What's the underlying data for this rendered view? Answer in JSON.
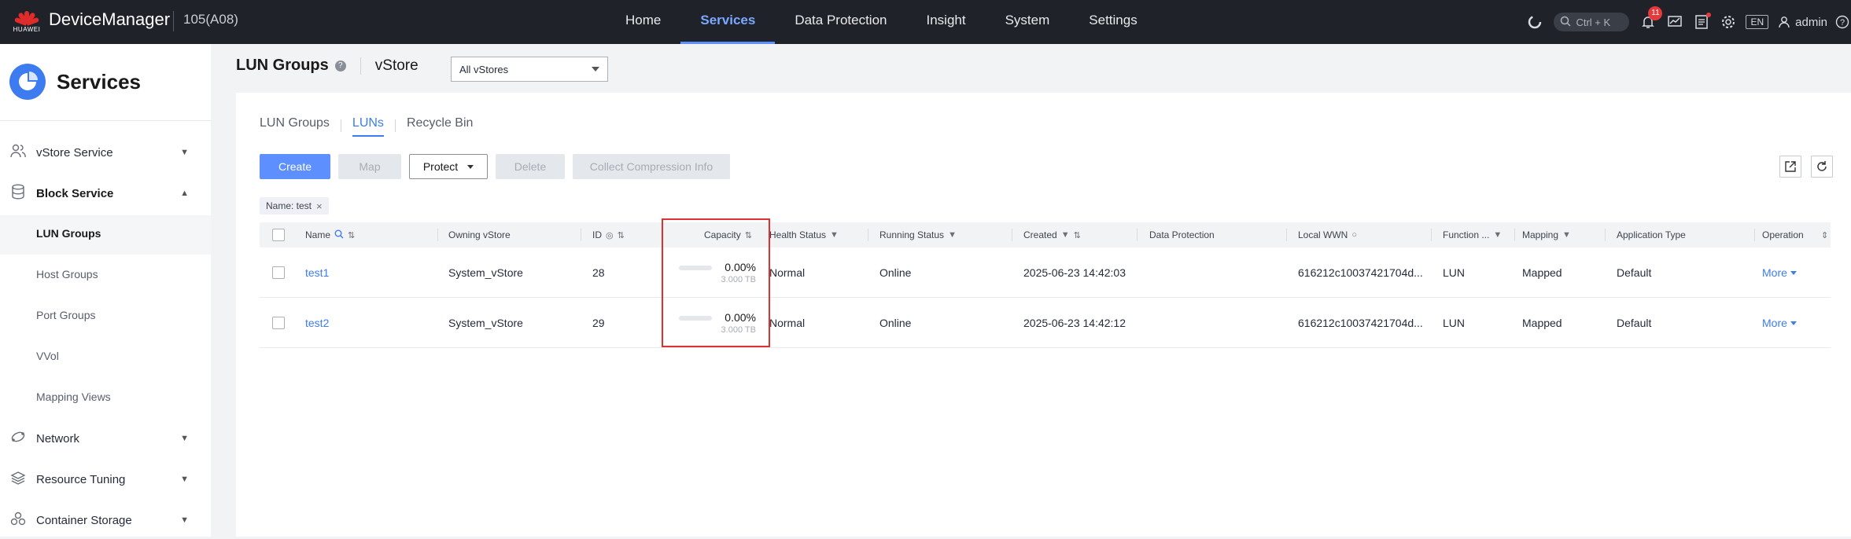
{
  "topbar": {
    "brand": "HUAWEI",
    "app_title": "DeviceManager",
    "device": "105(A08)",
    "nav": [
      "Home",
      "Services",
      "Data Protection",
      "Insight",
      "System",
      "Settings"
    ],
    "active_nav": "Services",
    "search_shortcut": "Ctrl + K",
    "notification_count": "11",
    "language": "EN",
    "user": "admin"
  },
  "sidebar": {
    "title": "Services",
    "groups": [
      {
        "label": "vStore Service",
        "icon": "users-icon"
      },
      {
        "label": "Block Service",
        "icon": "database-icon"
      },
      {
        "label": "Network",
        "icon": "network-icon"
      },
      {
        "label": "Resource Tuning",
        "icon": "layers-icon"
      },
      {
        "label": "Container Storage",
        "icon": "cluster-icon"
      }
    ],
    "block_items": [
      "LUN Groups",
      "Host Groups",
      "Port Groups",
      "VVol",
      "Mapping Views"
    ],
    "active_item": "LUN Groups"
  },
  "page": {
    "title": "LUN Groups",
    "vstore_label": "vStore",
    "vstore_value": "All vStores",
    "tabs": [
      "LUN Groups",
      "LUNs",
      "Recycle Bin"
    ],
    "active_tab": "LUNs",
    "buttons": {
      "create": "Create",
      "map": "Map",
      "protect": "Protect",
      "delete": "Delete",
      "collect": "Collect Compression Info"
    },
    "filter_chip": "Name: test"
  },
  "table": {
    "columns": {
      "name": "Name",
      "owning_vstore": "Owning vStore",
      "id": "ID",
      "capacity": "Capacity",
      "health": "Health Status",
      "running": "Running Status",
      "created": "Created",
      "data_protection": "Data Protection",
      "wwn": "Local WWN",
      "function": "Function ...",
      "mapping": "Mapping",
      "app_type": "Application Type",
      "operation": "Operation"
    },
    "rows": [
      {
        "name": "test1",
        "owning_vstore": "System_vStore",
        "id": "28",
        "capacity_pct": "0.00%",
        "capacity_total": "3.000 TB",
        "usage": 0,
        "health": "Normal",
        "running": "Online",
        "created": "2025-06-23 14:42:03",
        "data_protection": "",
        "wwn": "616212c10037421704d...",
        "function": "LUN",
        "mapping": "Mapped",
        "app_type": "Default",
        "operation": "More"
      },
      {
        "name": "test2",
        "owning_vstore": "System_vStore",
        "id": "29",
        "capacity_pct": "0.00%",
        "capacity_total": "3.000 TB",
        "usage": 0,
        "health": "Normal",
        "running": "Online",
        "created": "2025-06-23 14:42:12",
        "data_protection": "",
        "wwn": "616212c10037421704d...",
        "function": "LUN",
        "mapping": "Mapped",
        "app_type": "Default",
        "operation": "More"
      }
    ]
  },
  "colors": {
    "accent": "#3d7cf0",
    "highlight": "#e0302f"
  }
}
